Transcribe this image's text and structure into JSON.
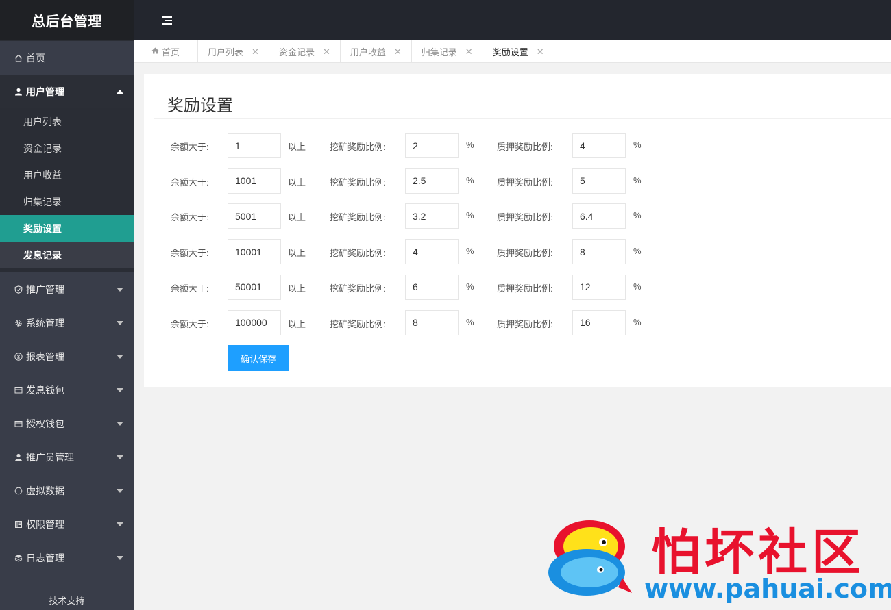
{
  "app": {
    "title": "总后台管理"
  },
  "sidebar": {
    "items": [
      {
        "label": "首页",
        "icon": "home-icon"
      },
      {
        "label": "用户管理",
        "icon": "user-icon",
        "open": true,
        "children": [
          {
            "label": "用户列表"
          },
          {
            "label": "资金记录"
          },
          {
            "label": "用户收益"
          },
          {
            "label": "归集记录"
          },
          {
            "label": "奖励设置",
            "active": true
          },
          {
            "label": "发息记录"
          }
        ]
      },
      {
        "label": "推广管理",
        "icon": "shield-icon"
      },
      {
        "label": "系统管理",
        "icon": "gear-icon"
      },
      {
        "label": "报表管理",
        "icon": "yen-icon"
      },
      {
        "label": "发息钱包",
        "icon": "wallet-icon"
      },
      {
        "label": "授权钱包",
        "icon": "wallet-icon"
      },
      {
        "label": "推广员管理",
        "icon": "user-icon"
      },
      {
        "label": "虚拟数据",
        "icon": "circle-icon"
      },
      {
        "label": "权限管理",
        "icon": "book-icon"
      },
      {
        "label": "日志管理",
        "icon": "layers-icon"
      }
    ],
    "support": "技术支持"
  },
  "tabs": [
    {
      "label": "首页",
      "closable": false
    },
    {
      "label": "用户列表",
      "closable": true
    },
    {
      "label": "资金记录",
      "closable": true
    },
    {
      "label": "用户收益",
      "closable": true
    },
    {
      "label": "归集记录",
      "closable": true
    },
    {
      "label": "奖励设置",
      "closable": true,
      "active": true
    }
  ],
  "form": {
    "title": "奖励设置",
    "balance_label": "余额大于:",
    "above_label": "以上",
    "mining_label": "挖矿奖励比例:",
    "pledge_label": "质押奖励比例:",
    "percent": "%",
    "rows": [
      {
        "balance": "1",
        "mining": "2",
        "pledge": "4"
      },
      {
        "balance": "1001",
        "mining": "2.5",
        "pledge": "5"
      },
      {
        "balance": "5001",
        "mining": "3.2",
        "pledge": "6.4"
      },
      {
        "balance": "10001",
        "mining": "4",
        "pledge": "8"
      },
      {
        "balance": "50001",
        "mining": "6",
        "pledge": "12"
      },
      {
        "balance": "100000",
        "mining": "8",
        "pledge": "16"
      }
    ],
    "save_label": "确认保存"
  },
  "watermark": {
    "brand": "怕坏社区",
    "url": "www.pahuai.com"
  },
  "colors": {
    "accent": "#209e91",
    "primary_button": "#1e9fff",
    "sidebar": "#393d49",
    "topbar": "#23262e"
  }
}
